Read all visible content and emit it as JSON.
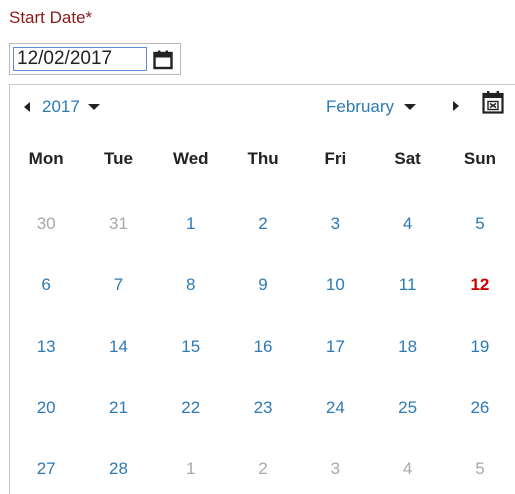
{
  "field": {
    "label": "Start Date*",
    "value": "12/02/2017"
  },
  "calendar": {
    "year": "2017",
    "month": "February",
    "weekdays": [
      "Mon",
      "Tue",
      "Wed",
      "Thu",
      "Fri",
      "Sat",
      "Sun"
    ],
    "weeks": [
      [
        {
          "d": "30",
          "other": true
        },
        {
          "d": "31",
          "other": true
        },
        {
          "d": "1"
        },
        {
          "d": "2"
        },
        {
          "d": "3"
        },
        {
          "d": "4"
        },
        {
          "d": "5"
        }
      ],
      [
        {
          "d": "6"
        },
        {
          "d": "7"
        },
        {
          "d": "8"
        },
        {
          "d": "9"
        },
        {
          "d": "10"
        },
        {
          "d": "11"
        },
        {
          "d": "12",
          "today": true
        }
      ],
      [
        {
          "d": "13"
        },
        {
          "d": "14"
        },
        {
          "d": "15"
        },
        {
          "d": "16"
        },
        {
          "d": "17"
        },
        {
          "d": "18"
        },
        {
          "d": "19"
        }
      ],
      [
        {
          "d": "20"
        },
        {
          "d": "21"
        },
        {
          "d": "22"
        },
        {
          "d": "23"
        },
        {
          "d": "24"
        },
        {
          "d": "25"
        },
        {
          "d": "26"
        }
      ],
      [
        {
          "d": "27"
        },
        {
          "d": "28"
        },
        {
          "d": "1",
          "other": true
        },
        {
          "d": "2",
          "other": true
        },
        {
          "d": "3",
          "other": true
        },
        {
          "d": "4",
          "other": true
        },
        {
          "d": "5",
          "other": true
        }
      ]
    ]
  },
  "colors": {
    "label": "#8b1a1a",
    "link": "#2d7ab5",
    "muted": "#a8a8a8",
    "highlight": "#cc0000"
  },
  "icons": {
    "open_picker": "calendar-icon",
    "previous": "caret-left-icon",
    "next": "caret-right-icon",
    "dropdown": "caret-down-icon",
    "clear": "calendar-clear-icon"
  }
}
